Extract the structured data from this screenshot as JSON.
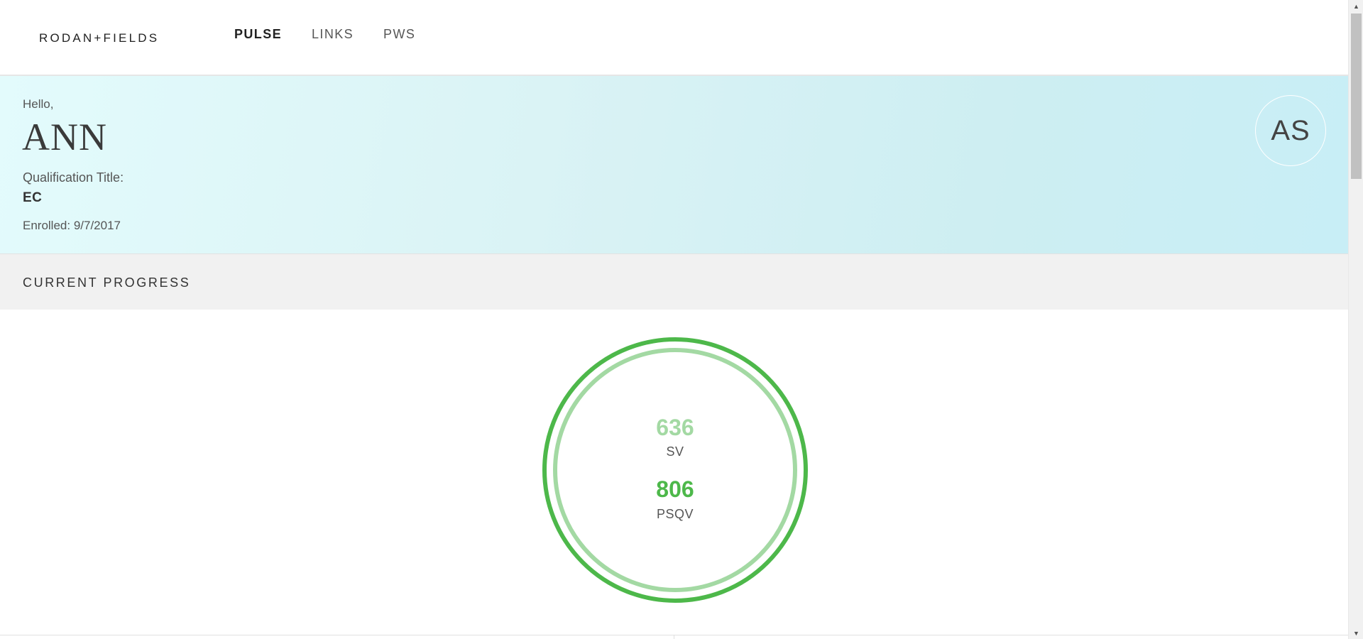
{
  "brand": {
    "logo_text": "RODAN+FIELDS"
  },
  "nav": {
    "items": [
      {
        "label": "PULSE",
        "active": true
      },
      {
        "label": "LINKS",
        "active": false
      },
      {
        "label": "PWS",
        "active": false
      }
    ]
  },
  "profile": {
    "greeting": "Hello,",
    "name": "ANN",
    "qualification_label": "Qualification Title:",
    "qualification_value": "EC",
    "enrolled": "Enrolled: 9/7/2017",
    "avatar_initials": "AS"
  },
  "progress": {
    "section_title": "CURRENT PROGRESS",
    "sv_value": "636",
    "sv_label": "SV",
    "psqv_value": "806",
    "psqv_label": "PSQV",
    "colors": {
      "outer_ring": "#4db84a",
      "inner_ring": "#a3d9a3"
    }
  },
  "icons": {
    "scroll_up": "triangle-up-icon",
    "scroll_down": "triangle-down-icon"
  }
}
